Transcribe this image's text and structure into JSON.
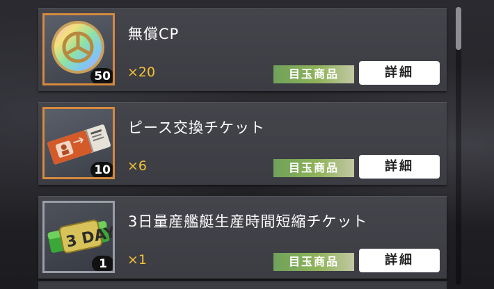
{
  "items": [
    {
      "name": "無償CP",
      "badge": "50",
      "count": "×20",
      "tag": "目玉商品",
      "button": "詳細",
      "icon": "rainbow-coin-icon"
    },
    {
      "name": "ピース交換チケット",
      "badge": "10",
      "count": "×6",
      "tag": "目玉商品",
      "button": "詳細",
      "icon": "piece-ticket-icon"
    },
    {
      "name": "3日量産艦艇生産時間短縮チケット",
      "badge": "1",
      "count": "×1",
      "tag": "目玉商品",
      "button": "詳細",
      "icon": "3day-ticket-icon",
      "icon_text": "3 DAY"
    }
  ],
  "colors": {
    "count": "#f5c434",
    "tag_green": "#6fa25a",
    "thumb_orange_border": "#d58a3d",
    "thumb_grey_border": "#9a9ea6"
  }
}
